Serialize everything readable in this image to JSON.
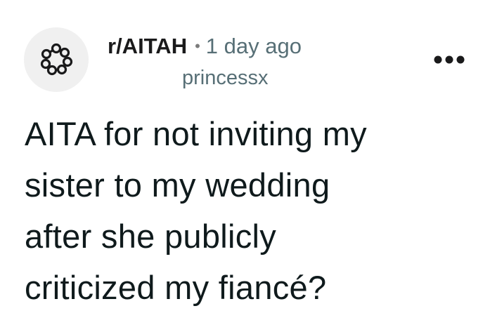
{
  "post": {
    "subreddit": "r/AITAH",
    "separator": "•",
    "time_ago": "1 day ago",
    "username": "princessx",
    "more_icon": "more-horizontal-icon",
    "avatar_icon": "community-ring-icon",
    "title_lines": [
      "AITA for not inviting my",
      "sister to my wedding",
      "after she publicly",
      "criticized my fiancé?"
    ]
  }
}
